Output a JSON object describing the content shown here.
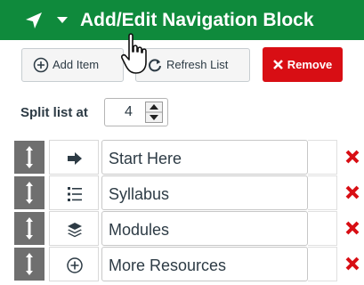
{
  "header": {
    "title": "Add/Edit Navigation Block",
    "icon": "location-arrow-icon",
    "color": "#0f8a3c"
  },
  "toolbar": {
    "add_label": "Add Item",
    "refresh_label": "Refresh List",
    "remove_label": "Remove",
    "remove_color": "#d80e14"
  },
  "split": {
    "label": "Split list at",
    "value": "4"
  },
  "items": [
    {
      "icon": "arrow-right-icon",
      "label": "Start Here"
    },
    {
      "icon": "list-icon",
      "label": "Syllabus"
    },
    {
      "icon": "layers-icon",
      "label": "Modules"
    },
    {
      "icon": "plus-circle-icon",
      "label": "More Resources"
    }
  ]
}
